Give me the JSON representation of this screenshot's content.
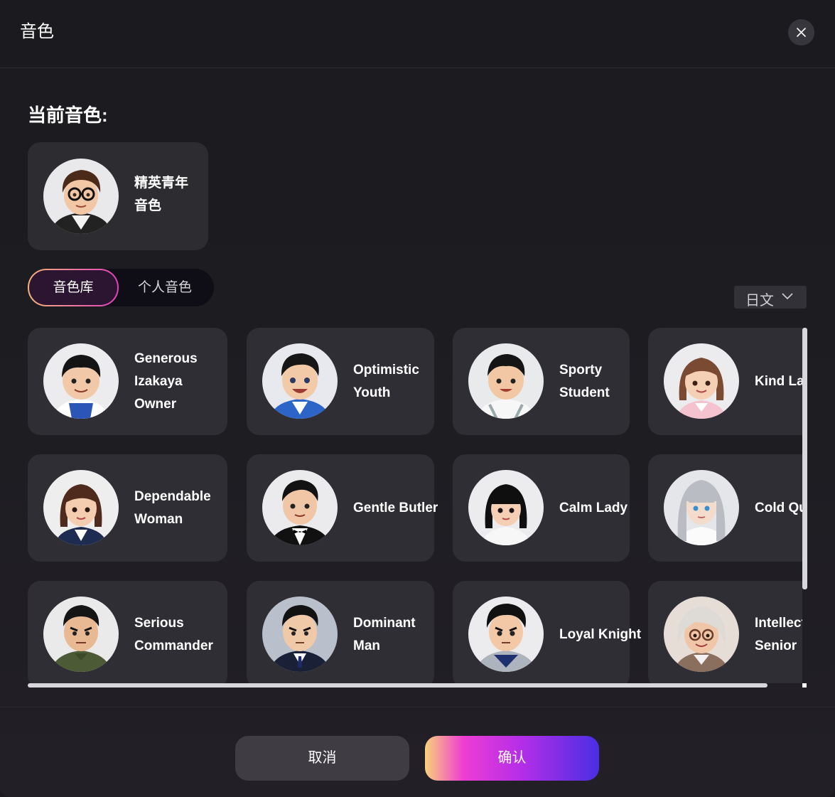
{
  "dialog": {
    "title": "音色"
  },
  "current": {
    "label": "当前音色:",
    "name": "精英青年音色"
  },
  "tabs": [
    {
      "label": "音色库",
      "active": true
    },
    {
      "label": "个人音色",
      "active": false
    }
  ],
  "language": {
    "selected": "日文"
  },
  "voices": [
    {
      "name": "Generous Izakaya Owner",
      "avatar": "boy-overalls"
    },
    {
      "name": "Optimistic Youth",
      "avatar": "boy-blue"
    },
    {
      "name": "Sporty Student",
      "avatar": "boy-white"
    },
    {
      "name": "Kind La",
      "avatar": "girl-pink"
    },
    {
      "name": "Dependable Woman",
      "avatar": "woman-suit"
    },
    {
      "name": "Gentle Butler",
      "avatar": "man-tux"
    },
    {
      "name": "Calm Lady",
      "avatar": "girl-black-hair"
    },
    {
      "name": "Cold Queen",
      "avatar": "silver-hair"
    },
    {
      "name": "Serious Commander",
      "avatar": "man-military"
    },
    {
      "name": "Dominant Man",
      "avatar": "man-suit"
    },
    {
      "name": "Loyal Knight",
      "avatar": "boy-armor"
    },
    {
      "name": "Intellect Senior",
      "avatar": "elder-glasses"
    }
  ],
  "footer": {
    "cancel": "取消",
    "confirm": "确认"
  },
  "colors": {
    "accent_start": "#f8d27a",
    "accent_mid": "#ee3dd3",
    "accent_end": "#4a2ee3",
    "card_bg": "#2f2e34"
  }
}
